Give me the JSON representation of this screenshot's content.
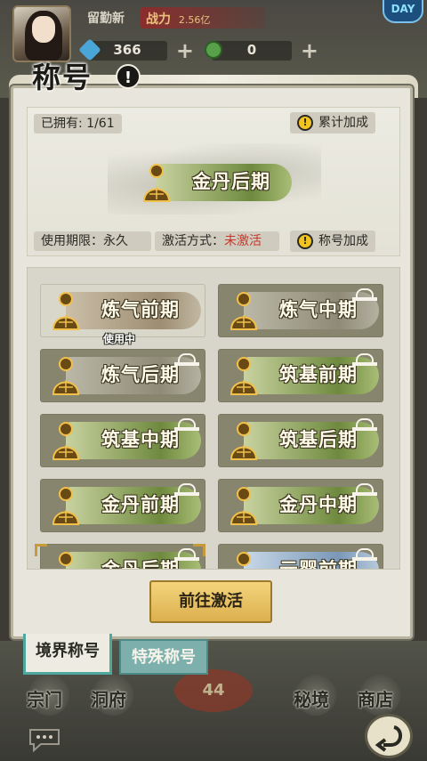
{
  "header": {
    "player_name": "留勤新",
    "power_label": "战力",
    "power_value": "2.56亿",
    "gems": "366",
    "jade": "0",
    "corner_badge": "DAY"
  },
  "panel": {
    "title": "称号",
    "owned_label": "已拥有: 1/61",
    "cumulative_bonus": "累计加成",
    "featured_title": "金丹后期",
    "validity_label": "使用期限：永久",
    "activation_label": "激活方式：",
    "activation_status": "未激活",
    "title_bonus": "称号加成"
  },
  "badges": [
    {
      "label": "炼气前期",
      "style": "tan",
      "locked": false,
      "selected": true
    },
    {
      "label": "炼气中期",
      "style": "grey",
      "locked": true,
      "selected": false
    },
    {
      "label": "炼气后期",
      "style": "grey",
      "locked": true,
      "selected": false
    },
    {
      "label": "筑基前期",
      "style": "green",
      "locked": true,
      "selected": false
    },
    {
      "label": "筑基中期",
      "style": "green",
      "locked": true,
      "selected": false
    },
    {
      "label": "筑基后期",
      "style": "green",
      "locked": true,
      "selected": false
    },
    {
      "label": "金丹前期",
      "style": "green",
      "locked": true,
      "selected": false
    },
    {
      "label": "金丹中期",
      "style": "green",
      "locked": true,
      "selected": false
    },
    {
      "label": "金丹后期",
      "style": "green",
      "locked": true,
      "selected": false
    },
    {
      "label": "元婴前期",
      "style": "blue",
      "locked": true,
      "selected": false
    }
  ],
  "in_use_label": "使用中",
  "activate_button": "前往激活",
  "tabs": [
    {
      "label": "境界称号",
      "active": true
    },
    {
      "label": "特殊称号",
      "active": false
    }
  ],
  "bottom_nav": {
    "sect": "宗门",
    "cave": "洞府",
    "level": "44",
    "secret": "秘境",
    "shop": "商店"
  },
  "icons": {
    "gem": "blue-gem-icon",
    "jade": "green-jade-icon",
    "buddha": "meditating-buddha-icon",
    "lock": "lock-icon",
    "warning": "exclamation-icon",
    "chat": "chat-bubble-icon",
    "back": "back-arrow-icon"
  },
  "colors": {
    "panel_bg": "#e8e6dc",
    "activate_gold": "#dcb04e",
    "tab_teal": "#4fa89e",
    "inactive_red": "#c8382a"
  }
}
